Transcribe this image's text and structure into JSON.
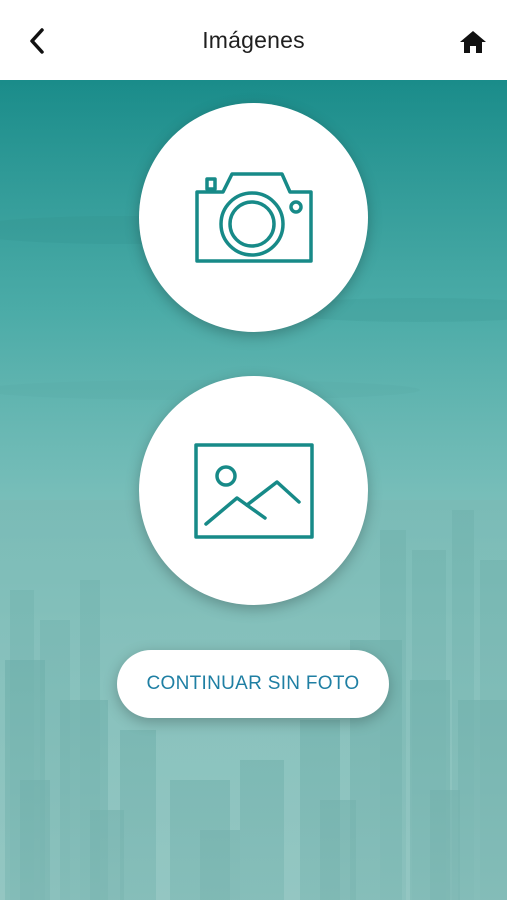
{
  "header": {
    "title": "Imágenes",
    "back_icon": "chevron-left-icon",
    "home_icon": "home-icon"
  },
  "actions": {
    "camera_icon": "camera-icon",
    "gallery_icon": "image-icon",
    "continue_label": "CONTINUAR SIN FOTO"
  },
  "colors": {
    "accent": "#178a88",
    "button_text": "#1f7fa3",
    "header_bg": "#ffffff"
  }
}
